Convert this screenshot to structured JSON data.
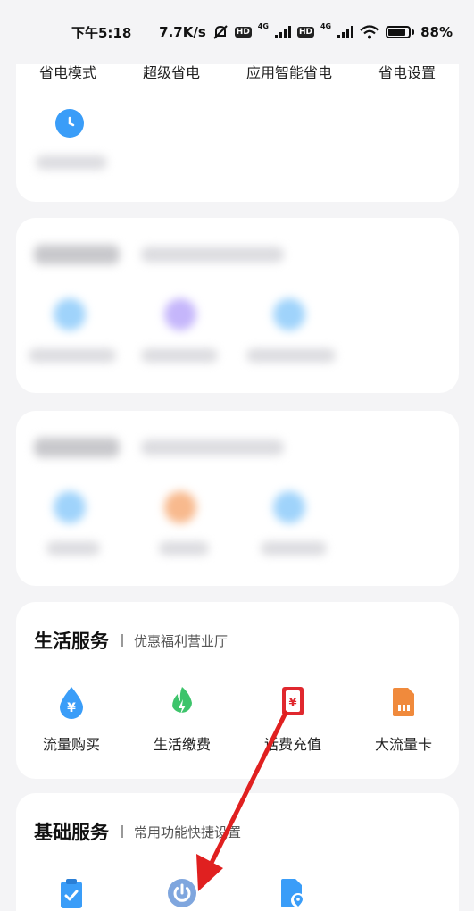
{
  "status_bar": {
    "time": "下午5:18",
    "speed": "7.7K/s",
    "hd": "HD",
    "net": "4G",
    "battery": "88%"
  },
  "power_card": {
    "items": [
      "省电模式",
      "超级省电",
      "应用智能省电",
      "省电设置"
    ]
  },
  "life_services": {
    "title": "生活服务",
    "subtitle": "优惠福利营业厅",
    "items": [
      {
        "label": "流量购买",
        "icon": "data-drop-icon"
      },
      {
        "label": "生活缴费",
        "icon": "flame-icon"
      },
      {
        "label": "话费充值",
        "icon": "recharge-icon"
      },
      {
        "label": "大流量卡",
        "icon": "sim-card-icon"
      }
    ]
  },
  "basic_services": {
    "title": "基础服务",
    "subtitle": "常用功能快捷设置",
    "items": [
      {
        "icon": "clipboard-check-icon"
      },
      {
        "icon": "power-icon"
      },
      {
        "icon": "location-doc-icon"
      }
    ]
  },
  "colors": {
    "accent_blue": "#3a9df8",
    "green": "#3dc46b",
    "orange": "#f08a3c",
    "red": "#e0282e",
    "arrow": "#e02020"
  }
}
